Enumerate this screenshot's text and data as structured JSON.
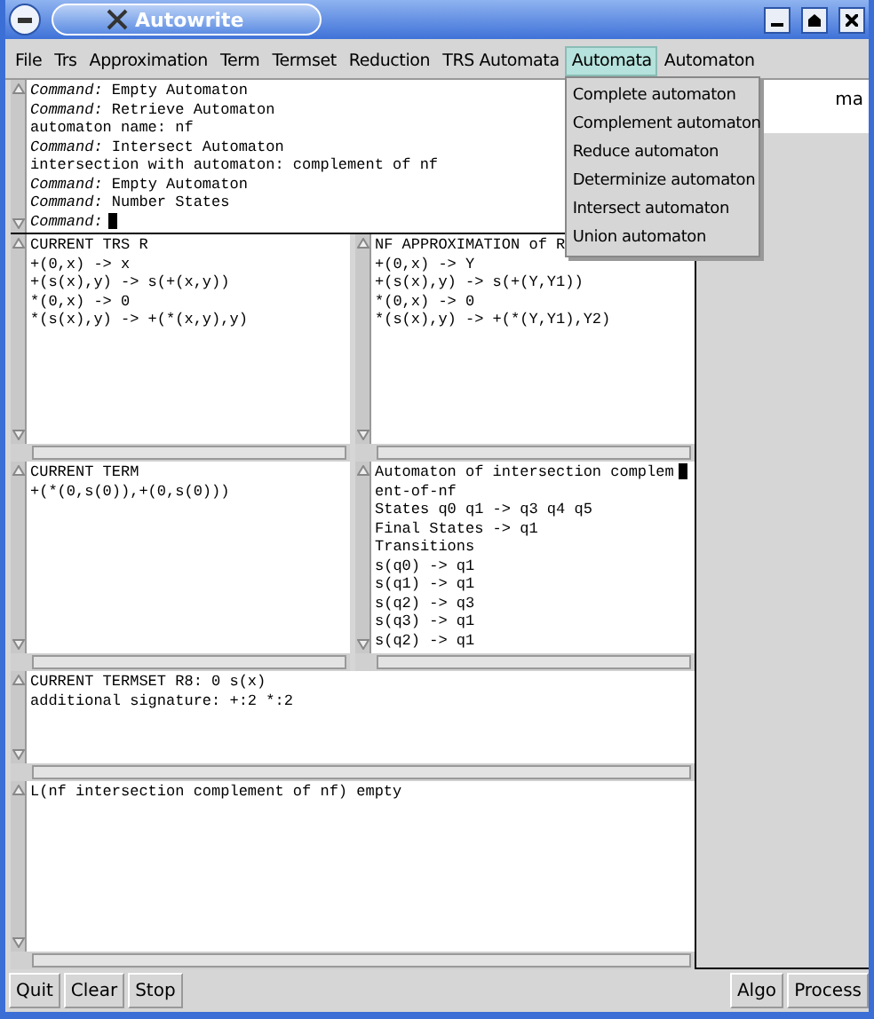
{
  "window": {
    "title": "Autowrite"
  },
  "menus": [
    {
      "label": "File",
      "selected": false
    },
    {
      "label": "Trs",
      "selected": false
    },
    {
      "label": "Approximation",
      "selected": false
    },
    {
      "label": "Term",
      "selected": false
    },
    {
      "label": "Termset",
      "selected": false
    },
    {
      "label": "Reduction",
      "selected": false
    },
    {
      "label": "TRS Automata",
      "selected": false
    },
    {
      "label": "Automata",
      "selected": true,
      "items": [
        "Complete automaton",
        "Complement automaton",
        "Reduce automaton",
        "Determinize automaton",
        "Intersect automaton",
        "Union automaton"
      ]
    },
    {
      "label": "Automaton",
      "selected": false
    }
  ],
  "console": {
    "lines": [
      {
        "kind": "command",
        "name": "Command:",
        "text": "Empty Automaton"
      },
      {
        "kind": "command",
        "name": "Command:",
        "text": "Retrieve Automaton"
      },
      {
        "kind": "output",
        "text": "automaton name: nf"
      },
      {
        "kind": "command",
        "name": "Command:",
        "text": "Intersect Automaton"
      },
      {
        "kind": "output",
        "text": "intersection with automaton: complement of nf"
      },
      {
        "kind": "command",
        "name": "Command:",
        "text": "Empty Automaton"
      },
      {
        "kind": "command",
        "name": "Command:",
        "text": "Number States"
      },
      {
        "kind": "prompt",
        "name": "Command:"
      }
    ]
  },
  "trs_pane": {
    "lines": [
      "CURRENT TRS R",
      "+(0,x) -> x",
      "+(s(x),y) -> s(+(x,y))",
      "*(0,x) -> 0",
      "*(s(x),y) -> +(*(x,y),y)"
    ]
  },
  "approx_pane": {
    "lines": [
      "NF APPROXIMATION of R",
      "+(0,x) -> Y",
      "+(s(x),y) -> s(+(Y,Y1))",
      "*(0,x) -> 0",
      "*(s(x),y) -> +(*(Y,Y1),Y2)"
    ]
  },
  "term_pane": {
    "lines": [
      "CURRENT TERM",
      "+(*(0,s(0)),+(0,s(0)))"
    ]
  },
  "automaton_pane": {
    "cursor": true,
    "lines": [
      "Automaton of intersection complem",
      "ent-of-nf",
      "States q0 q1 -> q3 q4 q5",
      "Final States -> q1",
      "Transitions",
      "s(q0) -> q1",
      "s(q1) -> q1",
      "s(q2) -> q3",
      "s(q3) -> q1",
      "s(q2) -> q1"
    ]
  },
  "termset_pane": {
    "lines": [
      "CURRENT TERMSET R8: 0 s(x)",
      "additional signature: +:2 *:2"
    ]
  },
  "result_pane": {
    "lines": [
      "L(nf intersection complement of nf) empty"
    ]
  },
  "side_panel": {
    "text": "ma"
  },
  "buttons_left": [
    "Quit",
    "Clear",
    "Stop"
  ],
  "buttons_right": [
    "Algo",
    "Process"
  ]
}
